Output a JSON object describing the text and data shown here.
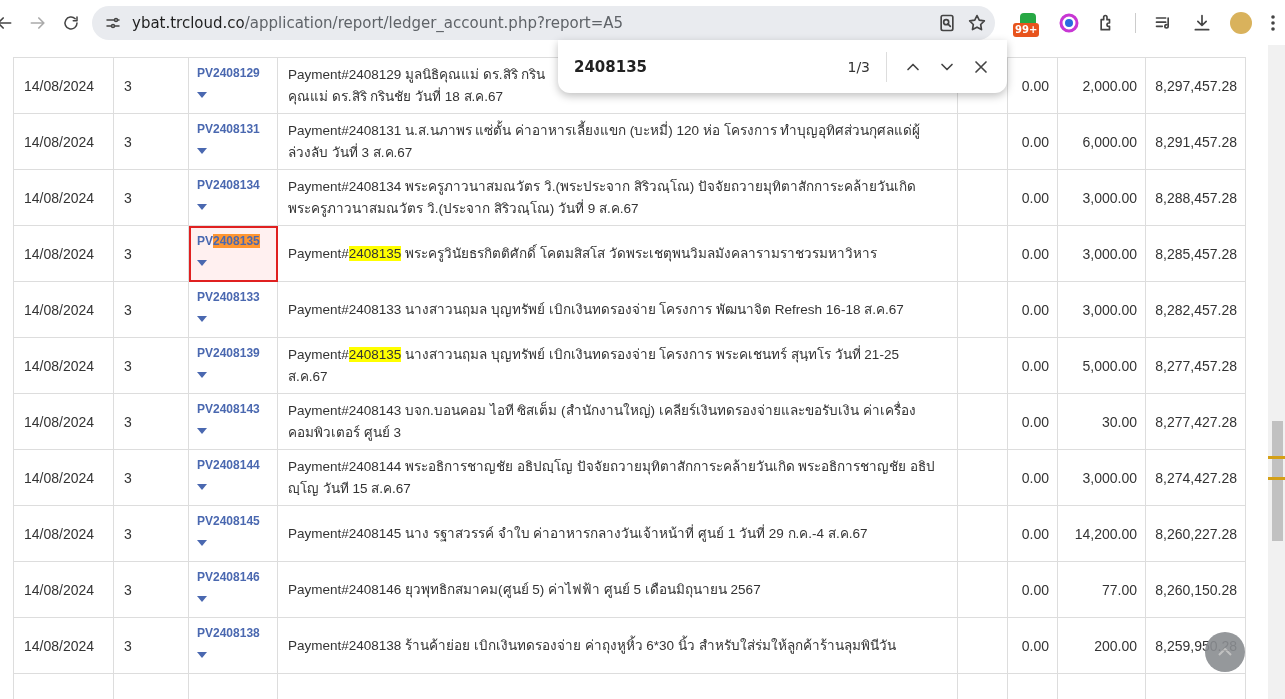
{
  "browser": {
    "url_host": "ybat.trcloud.co",
    "url_path": "/application/report/ledger_account.php?report=A5",
    "badge": "99+"
  },
  "find_bar": {
    "query": "2408135",
    "count": "1/3"
  },
  "rows": [
    {
      "date": "14/08/2024",
      "column_2": "3",
      "selected": false,
      "voucher": [
        {
          "text": "PV2408129",
          "highlighted": false
        }
      ],
      "description": [
        {
          "text": "Payment#2408129 มูลนิธิคุณแม่ ดร.สิริ กริน\nคุณแม่ ดร.สิริ กรินชัย วันที่ 18 ส.ค.67",
          "highlighted": false
        }
      ],
      "column_6": "0.00",
      "column_7": "2,000.00",
      "column_8": "8,297,457.28"
    },
    {
      "date": "14/08/2024",
      "column_2": "3",
      "selected": false,
      "voucher": [
        {
          "text": "PV2408131",
          "highlighted": false
        }
      ],
      "description": [
        {
          "text": "Payment#2408131 น.ส.นภาพร แซ่ตั้น ค่าอาหารเลี้ยงแขก (บะหมี่) 120 ห่อ โครงการ ทำบุญอุทิศส่วนกุศลแด่ผู้ล่วงลับ วันที่ 3 ส.ค.67",
          "highlighted": false
        }
      ],
      "column_6": "0.00",
      "column_7": "6,000.00",
      "column_8": "8,291,457.28"
    },
    {
      "date": "14/08/2024",
      "column_2": "3",
      "selected": false,
      "voucher": [
        {
          "text": "PV2408134",
          "highlighted": false
        }
      ],
      "description": [
        {
          "text": "Payment#2408134 พระครูภาวนาสมณวัตร วิ.(พระประจาก สิริวณฺโณ) ปัจจัยถวายมุทิตาสักการะคล้ายวันเกิด พระครูภาวนาสมณวัตร วิ.(ประจาก สิริวณฺโณ) วันที่ 9 ส.ค.67",
          "highlighted": false
        }
      ],
      "column_6": "0.00",
      "column_7": "3,000.00",
      "column_8": "8,288,457.28"
    },
    {
      "date": "14/08/2024",
      "column_2": "3",
      "selected": true,
      "voucher": [
        {
          "text": "PV",
          "highlighted": false
        },
        {
          "text": "2408135",
          "highlighted": true
        }
      ],
      "description": [
        {
          "text": "Payment#",
          "highlighted": false
        },
        {
          "text": "2408135",
          "highlighted": true
        },
        {
          "text": " พระครูวินัยธรกิตติศักดิ์ โคตมสิสโส วัดพระเชตุพนวิมลมังคลารามราชวรมหาวิหาร",
          "highlighted": false
        }
      ],
      "column_6": "0.00",
      "column_7": "3,000.00",
      "column_8": "8,285,457.28"
    },
    {
      "date": "14/08/2024",
      "column_2": "3",
      "selected": false,
      "voucher": [
        {
          "text": "PV2408133",
          "highlighted": false
        }
      ],
      "description": [
        {
          "text": "Payment#2408133 นางสาวนฤมล บุญทรัพย์ เบิกเงินทดรองจ่าย โครงการ พัฒนาจิต Refresh 16-18 ส.ค.67",
          "highlighted": false
        }
      ],
      "column_6": "0.00",
      "column_7": "3,000.00",
      "column_8": "8,282,457.28"
    },
    {
      "date": "14/08/2024",
      "column_2": "3",
      "selected": false,
      "voucher": [
        {
          "text": "PV2408139",
          "highlighted": false
        }
      ],
      "description": [
        {
          "text": "Payment#",
          "highlighted": false
        },
        {
          "text": "2408135",
          "highlighted": true
        },
        {
          "text": " นางสาวนฤมล บุญทรัพย์ เบิกเงินทดรองจ่าย โครงการ พระคเชนทร์ สุนฺทโร วันที่ 21-25 ส.ค.67",
          "highlighted": false
        }
      ],
      "column_6": "0.00",
      "column_7": "5,000.00",
      "column_8": "8,277,457.28"
    },
    {
      "date": "14/08/2024",
      "column_2": "3",
      "selected": false,
      "voucher": [
        {
          "text": "PV2408143",
          "highlighted": false
        }
      ],
      "description": [
        {
          "text": "Payment#2408143 บจก.บอนคอม ไอที ซิสเต็ม (สำนักงานใหญ่) เคลียร์เงินทดรองจ่ายและขอรับเงิน ค่าเครื่องคอมพิวเตอร์ ศูนย์ 3",
          "highlighted": false
        }
      ],
      "column_6": "0.00",
      "column_7": "30.00",
      "column_8": "8,277,427.28"
    },
    {
      "date": "14/08/2024",
      "column_2": "3",
      "selected": false,
      "voucher": [
        {
          "text": "PV2408144",
          "highlighted": false
        }
      ],
      "description": [
        {
          "text": "Payment#2408144 พระอธิการชาญชัย อธิปญฺโญ ปัจจัยถวายมุทิตาสักการะคล้ายวันเกิด พระอธิการชาญชัย อธิปญฺโญ วันที 15 ส.ค.67",
          "highlighted": false
        }
      ],
      "column_6": "0.00",
      "column_7": "3,000.00",
      "column_8": "8,274,427.28"
    },
    {
      "date": "14/08/2024",
      "column_2": "3",
      "selected": false,
      "voucher": [
        {
          "text": "PV2408145",
          "highlighted": false
        }
      ],
      "description": [
        {
          "text": "Payment#2408145 นาง รฐาสวรรค์ จำใบ ค่าอาหารกลางวันเจ้าหน้าที่ ศูนย์ 1 วันที่ 29 ก.ค.-4 ส.ค.67",
          "highlighted": false
        }
      ],
      "column_6": "0.00",
      "column_7": "14,200.00",
      "column_8": "8,260,227.28"
    },
    {
      "date": "14/08/2024",
      "column_2": "3",
      "selected": false,
      "voucher": [
        {
          "text": "PV2408146",
          "highlighted": false
        }
      ],
      "description": [
        {
          "text": "Payment#2408146 ยุวพุทธิกสมาคม(ศูนย์ 5) ค่าไฟฟ้า ศูนย์ 5 เดือนมิถุนายน 2567",
          "highlighted": false
        }
      ],
      "column_6": "0.00",
      "column_7": "77.00",
      "column_8": "8,260,150.28"
    },
    {
      "date": "14/08/2024",
      "column_2": "3",
      "selected": false,
      "voucher": [
        {
          "text": "PV2408138",
          "highlighted": false
        }
      ],
      "description": [
        {
          "text": "Payment#2408138 ร้านค้าย่อย เบิกเงินทดรองจ่าย ค่าถุงหูหิ้ว 6*30 นิ้ว สำหรับใส่ร่มให้ลูกค้าร้านลุมพินีวัน",
          "highlighted": false
        }
      ],
      "column_6": "0.00",
      "column_7": "200.00",
      "column_8": "8,259,950.28"
    }
  ]
}
